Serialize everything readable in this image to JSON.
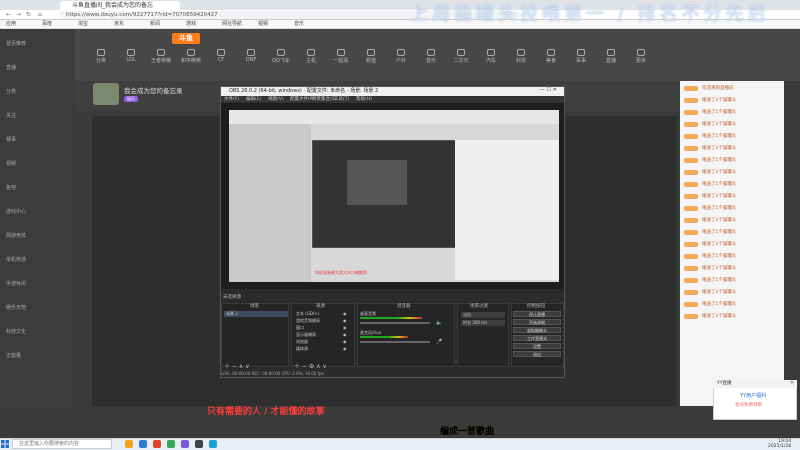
{
  "overlay_title": "上周猫罐头投喂第一 / 排名不分先后",
  "browser": {
    "tab_title": "斗鱼直播间_我会成为您的备忘",
    "url": "https://www.douyu.com/9227717?rid=7070659420427",
    "bookmarks": [
      "应用",
      "百度",
      "淘宝",
      "京东",
      "新闻",
      "游戏",
      "网址导航",
      "视频",
      "音乐"
    ]
  },
  "douyu": {
    "logo": "斗鱼",
    "left_nav": [
      "首页推荐",
      "直播",
      "分类",
      "关注",
      "赛事",
      "视频",
      "鱼吧",
      "游戏中心",
      "网游竞技",
      "单机热游",
      "手游休闲",
      "娱乐天地",
      "科技文化",
      "正能量"
    ],
    "top_nav": [
      "分类",
      "LOL",
      "王者荣耀",
      "和平精英",
      "CF",
      "DNF",
      "QQ飞车",
      "主机",
      "一起看",
      "颜值",
      "户外",
      "音乐",
      "二次元",
      "汽车",
      "科技",
      "美食",
      "军事",
      "直播",
      "更多"
    ],
    "room_title": "我会成为您的备忘录",
    "room_tag": "娱乐"
  },
  "obs": {
    "window_title": "OBS 26.0.2 (64-bit, windows) - 配置文件: 未命名 - 场景: 场景 2",
    "menu": [
      "文件(F)",
      "编辑(E)",
      "视图(V)",
      "配置文件(P)",
      "场景集合(S)",
      "工具(T)",
      "帮助(H)"
    ],
    "preview_label": "未选择源",
    "nested_caption": "叫欢迎感谢大家大众口碑推荐",
    "docks": {
      "scenes_header": "场景",
      "sources_header": "来源",
      "mixer_header": "混音器",
      "transition_header": "场景过渡",
      "controls_header": "控制按钮",
      "scenes": [
        "场景 2"
      ],
      "sources": [
        "文本 (GDI+)",
        "游戏音频捕获",
        "窗口",
        "显示器捕获",
        "浏览器",
        "媒体源"
      ],
      "mixer": [
        "桌面音频",
        "麦克风/Aux"
      ],
      "transition": [
        "淡出",
        "时长 300 ms"
      ],
      "controls": [
        "停止直播",
        "开始录制",
        "虚拟摄像头",
        "工作室模式",
        "设置",
        "退出"
      ]
    },
    "status": "LIVE: 00:00:00   REC: 00:00:00   CPU: 2.0%, 30.00 fps"
  },
  "chat": {
    "lines": [
      "欢迎来到直播间",
      "赠送了1个猫罐头",
      "赠送了1个猫罐头",
      "赠送了1个猫罐头",
      "赠送了1个猫罐头",
      "赠送了1个猫罐头",
      "赠送了1个猫罐头",
      "赠送了1个猫罐头",
      "赠送了1个猫罐头",
      "赠送了1个猫罐头",
      "赠送了1个猫罐头",
      "赠送了1个猫罐头",
      "赠送了1个猫罐头",
      "赠送了1个猫罐头",
      "赠送了1个猫罐头",
      "赠送了1个猫罐头",
      "赠送了1个猫罐头",
      "赠送了1个猫罐头",
      "赠送了1个猫罐头",
      "赠送了1个猫罐头"
    ],
    "ad_header": "YY直播",
    "ad_title": "YY用户福利",
    "ad_text": "会员免费领取"
  },
  "subtitles": {
    "line1": "只有需要的人 / 才能懂的故事",
    "line2": "编成一首歌曲"
  },
  "taskbar": {
    "search_placeholder": "在这里输入你要搜索的内容",
    "time": "19:04",
    "date": "2021/1/28"
  }
}
